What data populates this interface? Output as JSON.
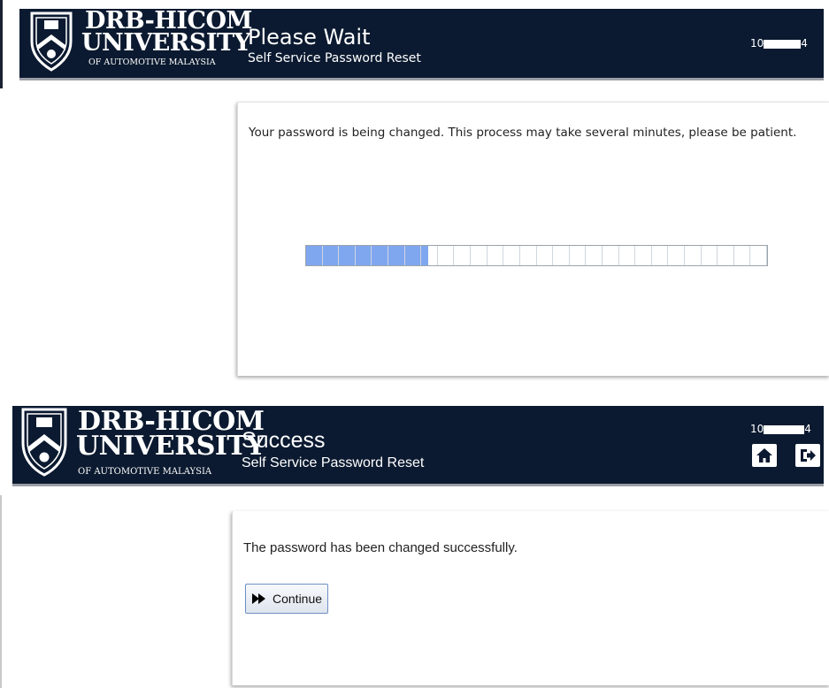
{
  "brand": {
    "line1": "DRB-HICOM",
    "line2": "UNIVERSITY",
    "line3": "OF AUTOMOTIVE MALAYSIA"
  },
  "screen_wait": {
    "title": "Please Wait",
    "subtitle": "Self Service Password Reset",
    "user_id_prefix": "10",
    "user_id_suffix": "4",
    "message": "Your password is being changed. This process may take several minutes, please be patient.",
    "progress": 0.265,
    "progress_segments": 28
  },
  "screen_success": {
    "title": "Success",
    "subtitle": "Self Service Password Reset",
    "user_id_prefix": "10",
    "user_id_suffix": "4",
    "message": "The password has been changed successfully.",
    "continue_label": "Continue",
    "home_icon": "home-icon",
    "logout_icon": "logout-icon"
  },
  "colors": {
    "header_bg": "#0b1a30",
    "progress_fill": "#7fa7ef"
  }
}
